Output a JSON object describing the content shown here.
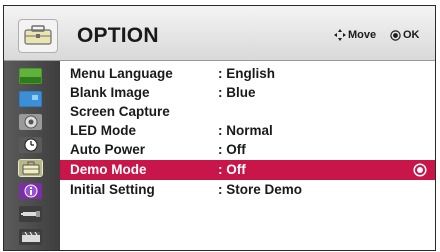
{
  "header": {
    "title": "OPTION",
    "hint_move": "Move",
    "hint_ok": "OK",
    "icon": "option-toolbox-icon"
  },
  "sidebar": {
    "items": [
      {
        "icon": "picture-icon"
      },
      {
        "icon": "screen-icon"
      },
      {
        "icon": "audio-icon"
      },
      {
        "icon": "time-icon"
      },
      {
        "icon": "option-icon",
        "selected": true
      },
      {
        "icon": "info-icon"
      },
      {
        "icon": "input-icon"
      },
      {
        "icon": "movie-icon"
      }
    ]
  },
  "menu": {
    "items": [
      {
        "label": "Menu Language",
        "value": ": English"
      },
      {
        "label": "Blank Image",
        "value": ": Blue"
      },
      {
        "label": "Screen Capture",
        "value": ""
      },
      {
        "label": "LED Mode",
        "value": ": Normal"
      },
      {
        "label": "Auto Power",
        "value": ": Off"
      },
      {
        "label": "Demo Mode",
        "value": ": Off",
        "highlighted": true
      },
      {
        "label": "Initial Setting",
        "value": ": Store Demo"
      }
    ]
  },
  "colors": {
    "highlight": "#c8164a",
    "sidebar": "#4a4a4a",
    "selected_icon_bg": "#b7b78a"
  }
}
